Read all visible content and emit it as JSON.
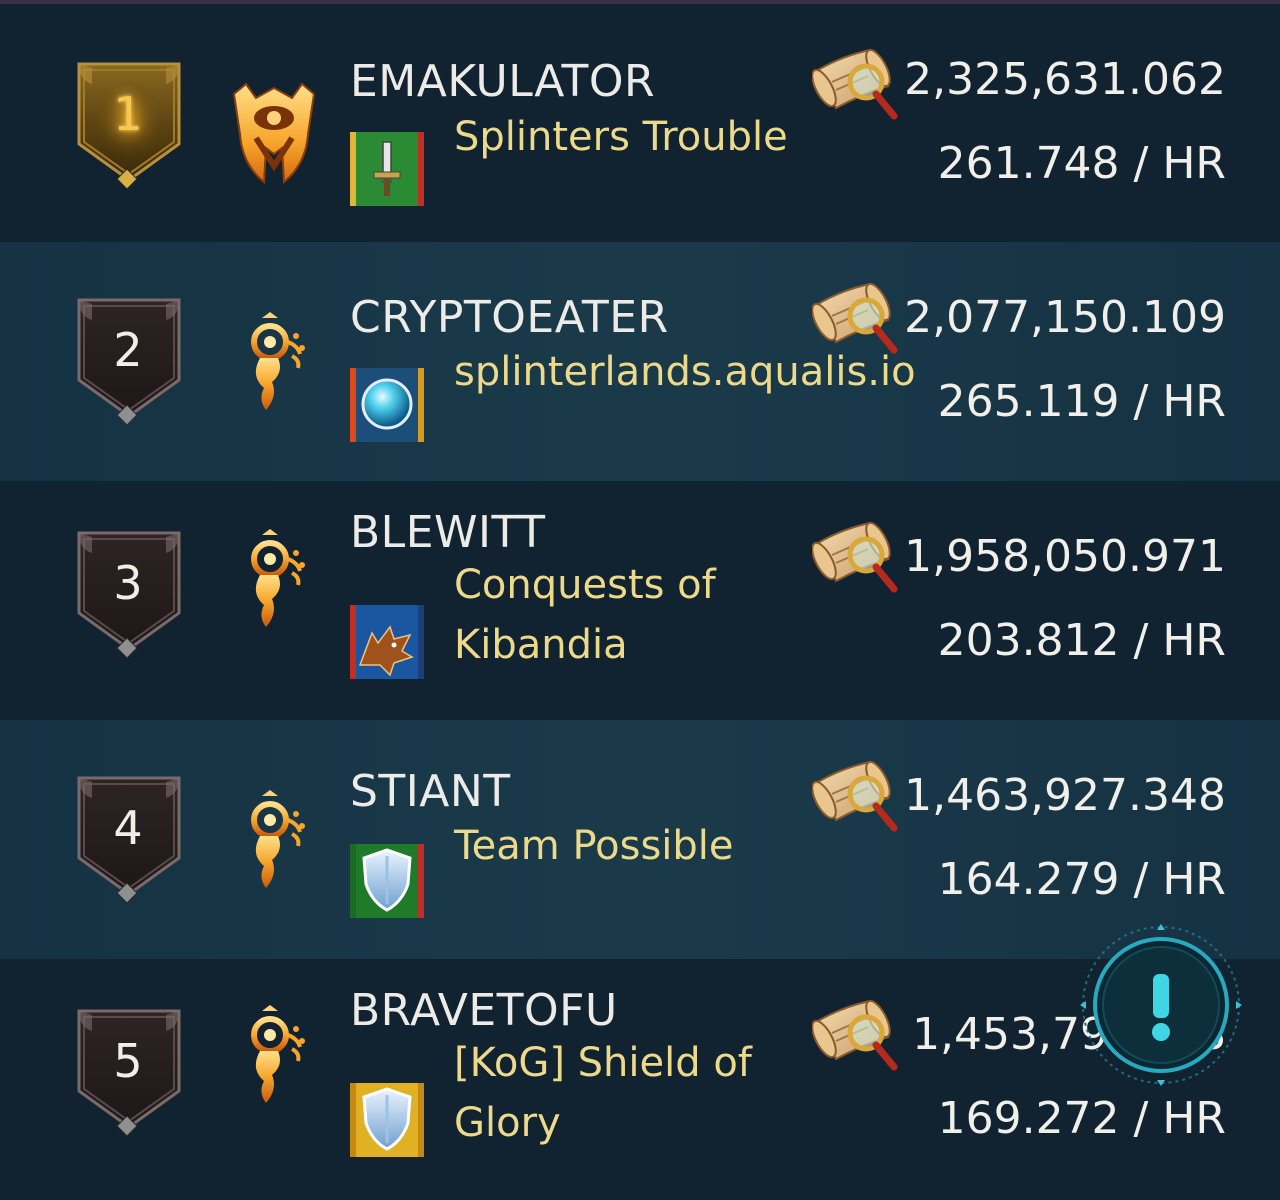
{
  "leaderboard": {
    "entries": [
      {
        "rank": "1",
        "player": "EMAKULATOR",
        "guild": "Splinters Trouble",
        "score": "2,325,631.062",
        "rate": "261.748 / HR",
        "league": "gold-league",
        "banner": "sword"
      },
      {
        "rank": "2",
        "player": "CRYPTOEATER",
        "guild": "splinterlands.aqualis.io",
        "score": "2,077,150.109",
        "rate": "265.119 / HR",
        "league": "flame-spirit",
        "banner": "orb"
      },
      {
        "rank": "3",
        "player": "BLEWITT",
        "guild": "Conquests of Kibandia",
        "guild_lines": [
          "Conquests of",
          "Kibandia"
        ],
        "score": "1,958,050.971",
        "rate": "203.812 / HR",
        "league": "flame-spirit",
        "banner": "wolf"
      },
      {
        "rank": "4",
        "player": "STIANT",
        "guild": "Team Possible",
        "score": "1,463,927.348",
        "rate": "164.279 / HR",
        "league": "flame-spirit",
        "banner": "shield-green"
      },
      {
        "rank": "5",
        "player": "BRAVETOFU",
        "guild": "[KoG] Shield of Glory",
        "guild_lines": [
          "[KoG] Shield of",
          "Glory"
        ],
        "score": "1,453,796.XX8",
        "score_visible": "1,453,79",
        "score_tail": "8",
        "rate": "169.272 / HR",
        "league": "flame-spirit",
        "banner": "shield-gold"
      }
    ]
  },
  "alert": {
    "icon": "exclamation-icon",
    "symbol": "!"
  },
  "colors": {
    "name": "#ecebe8",
    "guild": "#ecd98a",
    "gold": "#f7c84c",
    "bg_dark": "#112230",
    "bg_light": "#1a3a4a"
  }
}
